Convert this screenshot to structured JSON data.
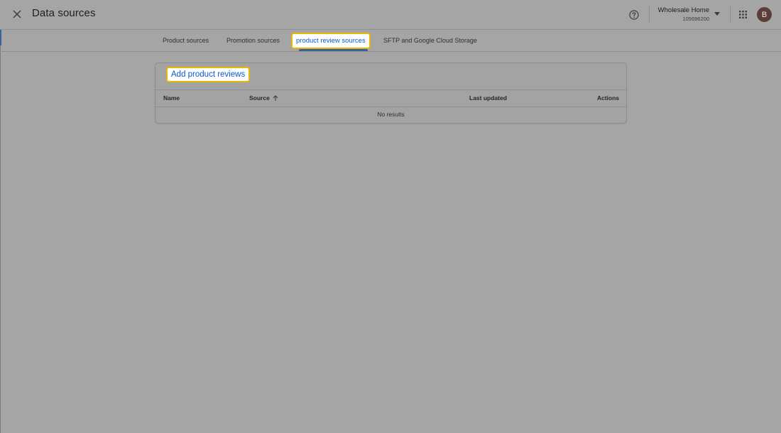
{
  "header": {
    "title": "Data sources",
    "close_icon": "close-icon",
    "help_icon": "help-circle-icon",
    "account": {
      "name": "Wholesale Home",
      "id": "105696200",
      "caret_icon": "caret-down-icon"
    },
    "apps_icon": "apps-grid-icon",
    "avatar_letter": "B"
  },
  "tabs": [
    {
      "label": "Product sources"
    },
    {
      "label": "Promotion sources"
    },
    {
      "label": "product review sources",
      "active": true
    },
    {
      "label": "SFTP and Google Cloud Storage"
    }
  ],
  "card": {
    "add_button_label": "Add product reviews",
    "columns": {
      "name": "Name",
      "source": "Source",
      "source_sort_icon": "arrow-up-icon",
      "last_updated": "Last updated",
      "actions": "Actions"
    },
    "empty_message": "No results"
  },
  "colors": {
    "overlay_background": "#a5a5a5",
    "link_blue": "#0b57d0",
    "highlight_border": "#e8b900",
    "avatar_bg": "#5a3f38"
  }
}
